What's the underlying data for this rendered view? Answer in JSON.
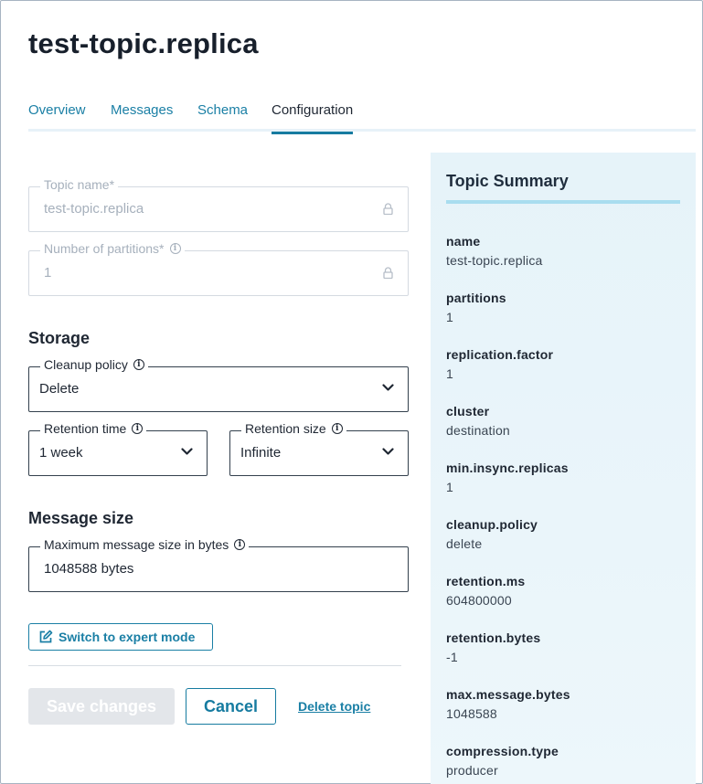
{
  "page": {
    "title": "test-topic.replica"
  },
  "tabs": [
    {
      "label": "Overview"
    },
    {
      "label": "Messages"
    },
    {
      "label": "Schema"
    },
    {
      "label": "Configuration",
      "active": true
    }
  ],
  "form": {
    "topic_name": {
      "label": "Topic name*",
      "value": "test-topic.replica"
    },
    "partitions": {
      "label": "Number of partitions*",
      "value": "1"
    },
    "storage": {
      "title": "Storage",
      "cleanup_policy": {
        "label": "Cleanup policy",
        "value": "Delete"
      },
      "retention_time": {
        "label": "Retention time",
        "value": "1 week"
      },
      "retention_size": {
        "label": "Retention size",
        "value": "Infinite"
      }
    },
    "message_size": {
      "title": "Message size",
      "max_bytes": {
        "label": "Maximum message size in bytes",
        "value": "1048588 bytes"
      }
    }
  },
  "actions": {
    "expert_mode": "Switch to expert mode",
    "save": "Save changes",
    "cancel": "Cancel",
    "delete": "Delete topic"
  },
  "summary": {
    "title": "Topic Summary",
    "items": [
      {
        "key": "name",
        "value": "test-topic.replica"
      },
      {
        "key": "partitions",
        "value": "1"
      },
      {
        "key": "replication.factor",
        "value": "1"
      },
      {
        "key": "cluster",
        "value": "destination"
      },
      {
        "key": "min.insync.replicas",
        "value": "1"
      },
      {
        "key": "cleanup.policy",
        "value": "delete"
      },
      {
        "key": "retention.ms",
        "value": "604800000"
      },
      {
        "key": "retention.bytes",
        "value": "-1"
      },
      {
        "key": "max.message.bytes",
        "value": "1048588"
      },
      {
        "key": "compression.type",
        "value": "producer"
      }
    ]
  },
  "colors": {
    "accent": "#167ba0",
    "link": "#1a7fa5",
    "summary_bg": "#e6f3f9",
    "summary_rule": "#a9ddef",
    "disabled_text": "#a6b0bc"
  },
  "icons": {
    "lock": "lock-icon",
    "info": "info-icon",
    "chevron": "chevron-down-icon",
    "edit": "edit-icon"
  }
}
